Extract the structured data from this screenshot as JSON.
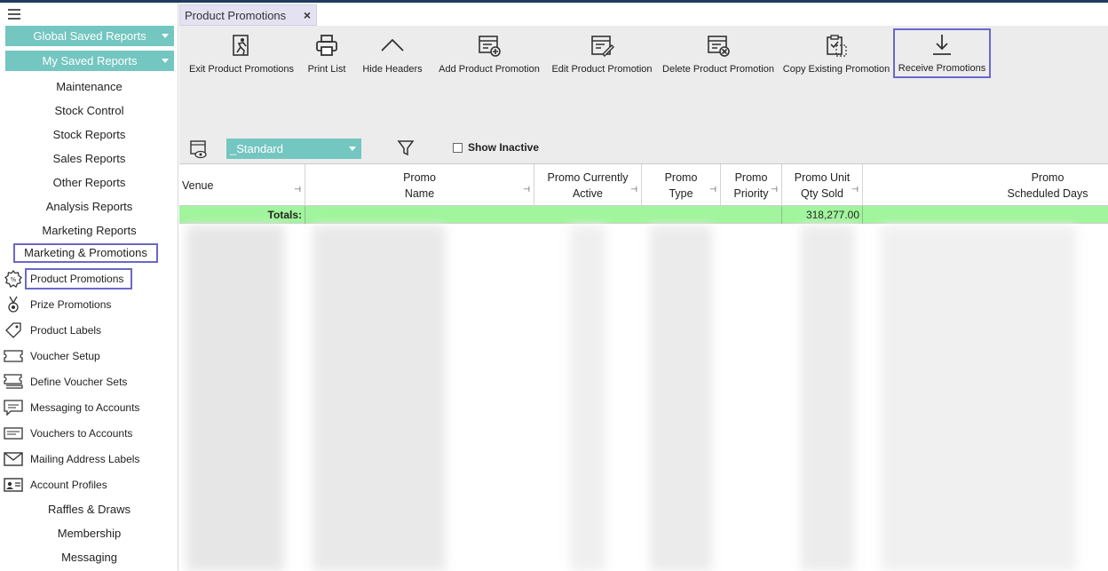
{
  "sidebar": {
    "reports": [
      {
        "label": "Global Saved Reports"
      },
      {
        "label": "My Saved Reports"
      }
    ],
    "menu": [
      {
        "label": "Maintenance"
      },
      {
        "label": "Stock Control"
      },
      {
        "label": "Stock Reports"
      },
      {
        "label": "Sales Reports"
      },
      {
        "label": "Other Reports"
      },
      {
        "label": "Analysis Reports"
      },
      {
        "label": "Marketing Reports"
      },
      {
        "label": "Marketing & Promotions"
      }
    ],
    "sub_items": [
      {
        "label": "Product Promotions",
        "icon": "promo-badge-icon"
      },
      {
        "label": "Prize Promotions",
        "icon": "medal-icon"
      },
      {
        "label": "Product Labels",
        "icon": "tag-icon"
      },
      {
        "label": "Voucher Setup",
        "icon": "ticket-icon"
      },
      {
        "label": "Define Voucher Sets",
        "icon": "tickets-icon"
      },
      {
        "label": "Messaging to Accounts",
        "icon": "message-icon"
      },
      {
        "label": "Vouchers to Accounts",
        "icon": "voucher-account-icon"
      },
      {
        "label": "Mailing Address Labels",
        "icon": "mail-icon"
      },
      {
        "label": "Account Profiles",
        "icon": "profile-card-icon"
      }
    ],
    "menu_bottom": [
      {
        "label": "Raffles & Draws"
      },
      {
        "label": "Membership"
      },
      {
        "label": "Messaging"
      }
    ]
  },
  "tab": {
    "label": "Product Promotions",
    "close": "×"
  },
  "toolbar": [
    {
      "label": "Exit Product Promotions",
      "icon": "exit-run-icon"
    },
    {
      "label": "Print List",
      "icon": "printer-icon"
    },
    {
      "label": "Hide Headers",
      "icon": "chevron-up-icon"
    },
    {
      "label": "Add Product Promotion",
      "icon": "add-doc-icon"
    },
    {
      "label": "Edit Product Promotion",
      "icon": "edit-doc-icon"
    },
    {
      "label": "Delete Product Promotion",
      "icon": "delete-doc-icon"
    },
    {
      "label": "Copy Existing Promotion",
      "icon": "copy-clipboard-icon"
    },
    {
      "label": "Receive Promotions",
      "icon": "download-icon"
    }
  ],
  "filter": {
    "layout": "_Standard",
    "show_inactive": "Show Inactive"
  },
  "grid": {
    "columns": [
      {
        "line1": "Venue",
        "line2": ""
      },
      {
        "line1": "Promo",
        "line2": "Name"
      },
      {
        "line1": "Promo Currently",
        "line2": "Active"
      },
      {
        "line1": "Promo",
        "line2": "Type"
      },
      {
        "line1": "Promo",
        "line2": "Priority"
      },
      {
        "line1": "Promo Unit",
        "line2": "Qty Sold"
      },
      {
        "line1": "Promo",
        "line2": "Scheduled Days"
      }
    ],
    "totals_label": "Totals:",
    "totals_qty": "318,277.00"
  },
  "colors": {
    "accent": "#74c6c0",
    "highlight_box": "#6a68c9",
    "totals_bg": "#a1f59c"
  }
}
